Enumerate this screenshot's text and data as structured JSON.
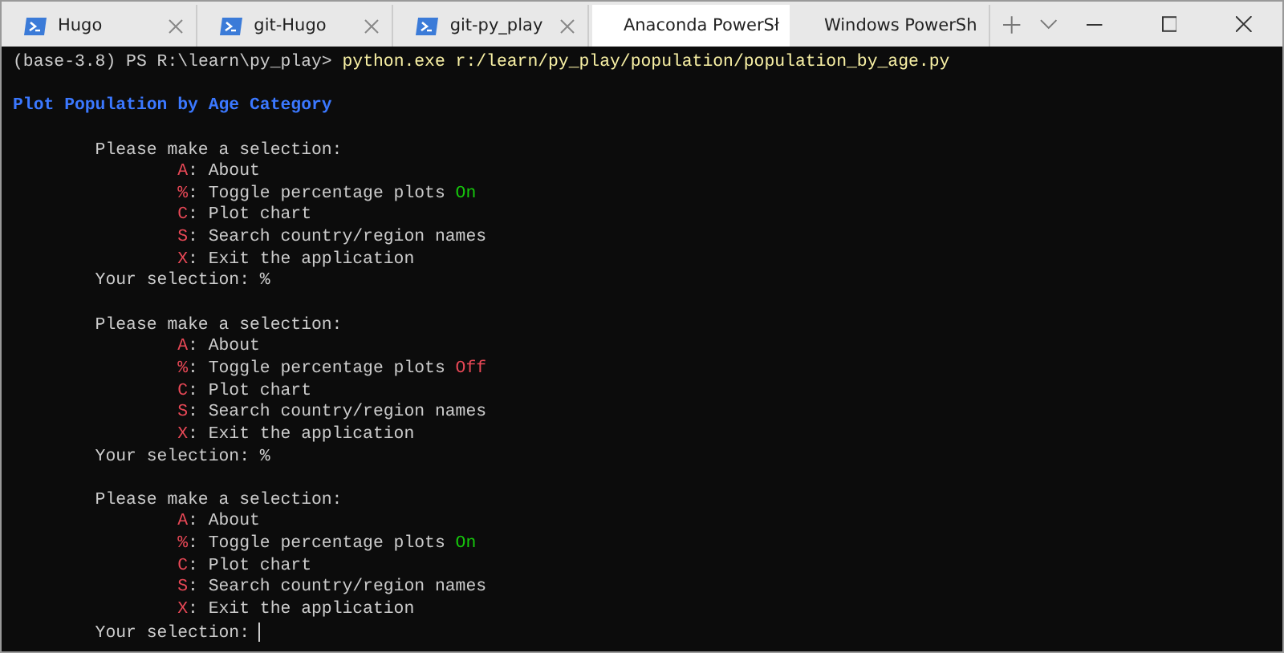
{
  "tabs": [
    {
      "title": "Hugo",
      "kind": "powershell",
      "selected": false
    },
    {
      "title": "git-Hugo",
      "kind": "powershell",
      "selected": false
    },
    {
      "title": "git-py_play",
      "kind": "powershell",
      "selected": false
    },
    {
      "title": "Anaconda PowerSł",
      "kind": "console",
      "selected": true
    },
    {
      "title": "Windows PowerSh",
      "kind": "powershell",
      "selected": false
    }
  ],
  "terminal": {
    "prompt": "(base-3.8) PS R:\\learn\\py_play>",
    "command": "python.exe r:/learn/py_play/population/population_by_age.py",
    "title": "Plot Population by Age Category",
    "menus": [
      {
        "heading": "Please make a selection:",
        "options": [
          {
            "key": "A",
            "label": ": About"
          },
          {
            "key": "%",
            "label": ": Toggle percentage plots",
            "status": {
              "text": "On",
              "on": true
            }
          },
          {
            "key": "C",
            "label": ": Plot chart"
          },
          {
            "key": "S",
            "label": ": Search country/region names"
          },
          {
            "key": "X",
            "label": ": Exit the application"
          }
        ],
        "prompt": "Your selection:",
        "input": "%",
        "cursor": false
      },
      {
        "heading": "Please make a selection:",
        "options": [
          {
            "key": "A",
            "label": ": About"
          },
          {
            "key": "%",
            "label": ": Toggle percentage plots",
            "status": {
              "text": "Off",
              "on": false
            }
          },
          {
            "key": "C",
            "label": ": Plot chart"
          },
          {
            "key": "S",
            "label": ": Search country/region names"
          },
          {
            "key": "X",
            "label": ": Exit the application"
          }
        ],
        "prompt": "Your selection:",
        "input": "%",
        "cursor": false
      },
      {
        "heading": "Please make a selection:",
        "options": [
          {
            "key": "A",
            "label": ": About"
          },
          {
            "key": "%",
            "label": ": Toggle percentage plots",
            "status": {
              "text": "On",
              "on": true
            }
          },
          {
            "key": "C",
            "label": ": Plot chart"
          },
          {
            "key": "S",
            "label": ": Search country/region names"
          },
          {
            "key": "X",
            "label": ": Exit the application"
          }
        ],
        "prompt": "Your selection:",
        "cursor": true
      }
    ]
  }
}
